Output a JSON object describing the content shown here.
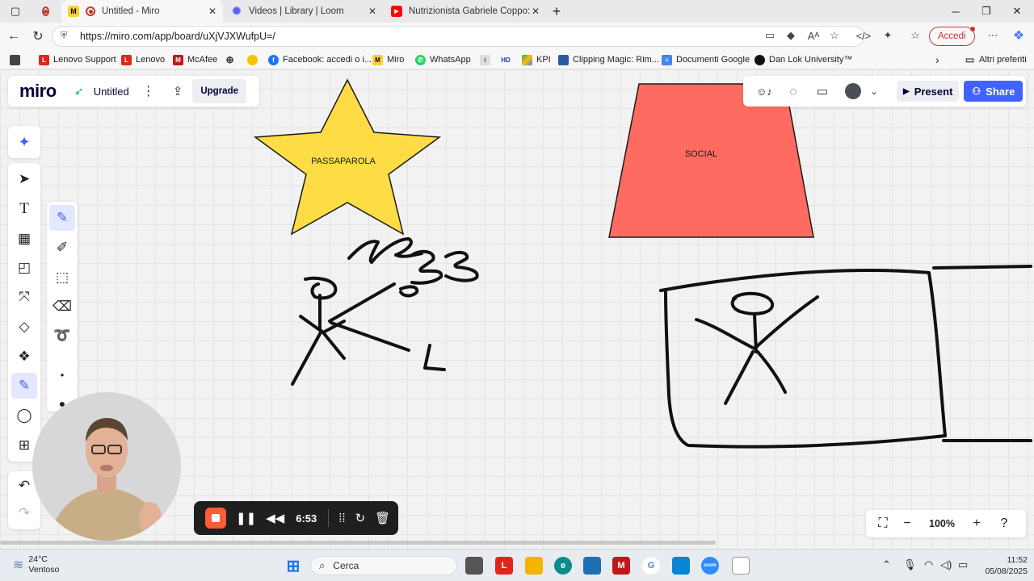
{
  "browser": {
    "tabs": [
      {
        "title": "Untitled - Miro"
      },
      {
        "title": "Videos | Library | Loom"
      },
      {
        "title": "Nutrizionista Gabriele Coppo: acq"
      }
    ],
    "new_tab": "+",
    "url": "https://miro.com/app/board/uXjVJXWufpU=/",
    "signin_label": "Accedi",
    "bookmarks": [
      "Lenovo Support",
      "Lenovo",
      "McAfee",
      "Facebook: accedi o i...",
      "Miro",
      "WhatsApp",
      "KPI",
      "Clipping Magic: Rim...",
      "Documenti Google",
      "Dan Lok University™"
    ],
    "other_bookmarks": "Altri preferiti"
  },
  "miro": {
    "logo": "miro",
    "board_title": "Untitled",
    "upgrade_label": "Upgrade",
    "present_label": "Present",
    "share_label": "Share",
    "zoom": "100%",
    "shapes": {
      "star_label": "PASSAPAROLA",
      "trapezoid_label": "SOCIAL"
    },
    "colors": {
      "star_fill": "#fddc45",
      "trapezoid_fill": "#ff6b61",
      "accent": "#4262ff"
    }
  },
  "recorder": {
    "elapsed": "6:53",
    "stop_color": "#ff5b38"
  },
  "taskbar": {
    "temperature": "24°C",
    "weather": "Ventoso",
    "search_placeholder": "Cerca",
    "time": "11:52",
    "date": "05/08/2025"
  }
}
